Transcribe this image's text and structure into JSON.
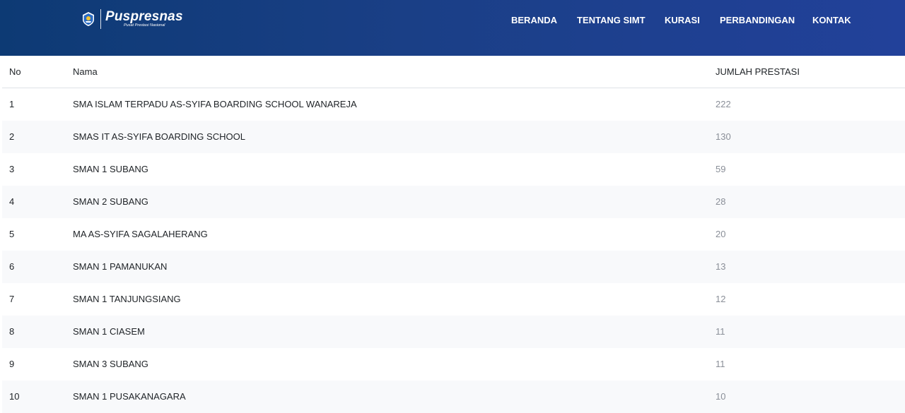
{
  "header": {
    "brand": "Puspresnas",
    "brand_sub": "Pusat Prestasi Nasional",
    "nav": [
      "BERANDA",
      "TENTANG SIMT",
      "KURASI",
      "PERBANDINGAN",
      "KONTAK"
    ]
  },
  "table": {
    "columns": [
      "No",
      "Nama",
      "JUMLAH PRESTASI"
    ],
    "rows": [
      {
        "no": "1",
        "nama": "SMA ISLAM TERPADU AS-SYIFA BOARDING SCHOOL WANAREJA",
        "jumlah": "222"
      },
      {
        "no": "2",
        "nama": "SMAS IT AS-SYIFA BOARDING SCHOOL",
        "jumlah": "130"
      },
      {
        "no": "3",
        "nama": "SMAN 1 SUBANG",
        "jumlah": "59"
      },
      {
        "no": "4",
        "nama": "SMAN 2 SUBANG",
        "jumlah": "28"
      },
      {
        "no": "5",
        "nama": "MA AS-SYIFA SAGALAHERANG",
        "jumlah": "20"
      },
      {
        "no": "6",
        "nama": "SMAN 1 PAMANUKAN",
        "jumlah": "13"
      },
      {
        "no": "7",
        "nama": "SMAN 1 TANJUNGSIANG",
        "jumlah": "12"
      },
      {
        "no": "8",
        "nama": "SMAN 1 CIASEM",
        "jumlah": "11"
      },
      {
        "no": "9",
        "nama": "SMAN 3 SUBANG",
        "jumlah": "11"
      },
      {
        "no": "10",
        "nama": "SMAN 1 PUSAKANAGARA",
        "jumlah": "10"
      }
    ]
  },
  "colors": {
    "header_start": "#0d3a74",
    "header_end": "#22419a",
    "stripe": "#f8f9fb",
    "muted_value": "#8a8f98"
  },
  "icons": {
    "logo_emblem": "tut-wuri-handayani-emblem"
  }
}
